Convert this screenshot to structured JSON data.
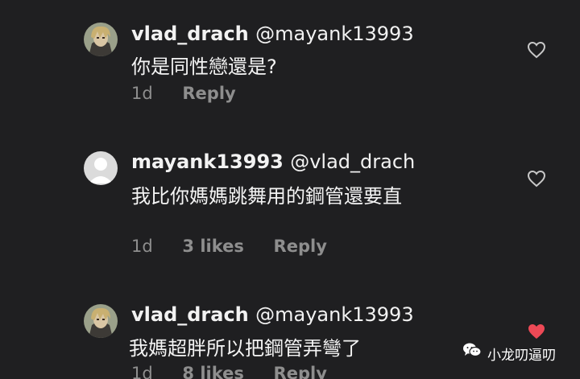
{
  "comments": [
    {
      "avatar": "anime-character-avatar",
      "username": "vlad_drach",
      "mention": "@mayank13993",
      "text": "你是同性戀還是?",
      "time": "1d",
      "likes": "",
      "reply": "Reply",
      "liked": false
    },
    {
      "avatar": "default-user-avatar",
      "username": "mayank13993",
      "mention": "@vlad_drach",
      "text": "我比你媽媽跳舞用的鋼管還要直",
      "time": "1d",
      "likes": "3 likes",
      "reply": "Reply",
      "liked": false
    },
    {
      "avatar": "anime-character-avatar",
      "username": "vlad_drach",
      "mention": "@mayank13993",
      "text": "我媽超胖所以把鋼管弄彎了",
      "time": "1d",
      "likes": "8 likes",
      "reply": "Reply",
      "liked": true
    }
  ],
  "watermark": {
    "icon": "wechat-icon",
    "text": "小龙叨逼叨"
  },
  "colors": {
    "background": "#1f1f21",
    "heart_liked": "#ed4956",
    "meta": "#8e8e8e"
  }
}
